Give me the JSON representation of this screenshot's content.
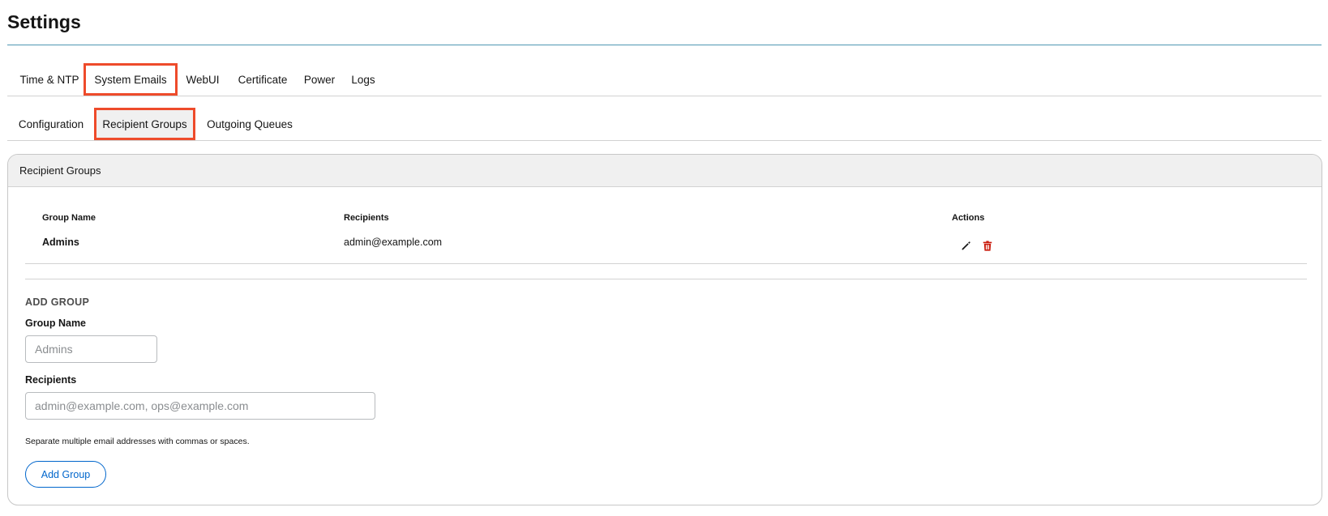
{
  "page": {
    "title": "Settings"
  },
  "primary_tabs": [
    {
      "label": "Time & NTP"
    },
    {
      "label": "System Emails"
    },
    {
      "label": "WebUI"
    },
    {
      "label": "Certificate"
    },
    {
      "label": "Power"
    },
    {
      "label": "Logs"
    }
  ],
  "secondary_tabs": [
    {
      "label": "Configuration"
    },
    {
      "label": "Recipient Groups"
    },
    {
      "label": "Outgoing Queues"
    }
  ],
  "card": {
    "title": "Recipient Groups",
    "columns": {
      "group_name": "Group Name",
      "recipients": "Recipients",
      "actions": "Actions"
    },
    "rows": [
      {
        "group_name": "Admins",
        "recipients": "admin@example.com"
      }
    ]
  },
  "add_group": {
    "title": "ADD GROUP",
    "group_name_label": "Group Name",
    "group_name_placeholder": "Admins",
    "recipients_label": "Recipients",
    "recipients_placeholder": "admin@example.com, ops@example.com",
    "helper": "Separate multiple email addresses with commas or spaces.",
    "button": "Add Group"
  },
  "colors": {
    "highlight": "#ee4b2b",
    "accent": "#0066cc",
    "danger": "#c9190b",
    "title_rule": "#4f97b3"
  },
  "icons": {
    "edit": "pencil-icon",
    "delete": "trash-icon"
  }
}
